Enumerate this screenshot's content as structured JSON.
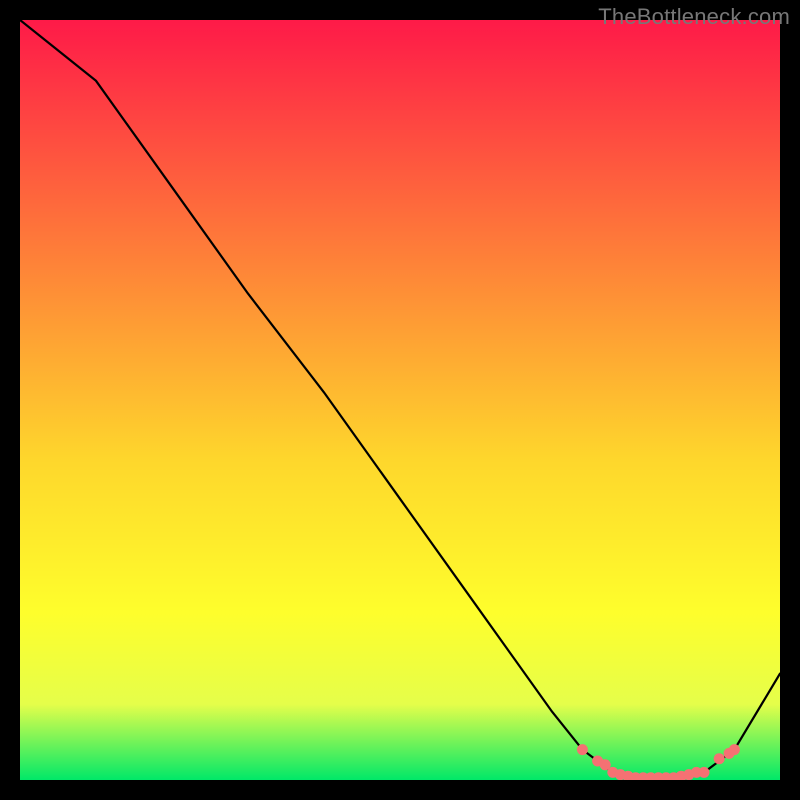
{
  "watermark": "TheBottleneck.com",
  "colors": {
    "gradient_top": "#fe1a48",
    "gradient_mid1": "#fe7c39",
    "gradient_mid2": "#fed72c",
    "gradient_mid3": "#fefe2c",
    "gradient_mid4": "#e5fe4a",
    "gradient_bottom": "#00e868",
    "curve": "#000000",
    "markers": "#f57173",
    "background": "#000000"
  },
  "chart_data": {
    "type": "line",
    "title": "",
    "xlabel": "",
    "ylabel": "",
    "xlim": [
      0,
      100
    ],
    "ylim": [
      0,
      100
    ],
    "curve": {
      "x": [
        0,
        5,
        10,
        20,
        30,
        40,
        50,
        60,
        65,
        70,
        74,
        78,
        82,
        86,
        90,
        94,
        100
      ],
      "y": [
        100,
        96,
        92,
        78,
        64,
        51,
        37,
        23,
        16,
        9,
        4,
        1,
        0.3,
        0.3,
        1,
        4,
        14
      ]
    },
    "series": [
      {
        "name": "flat-valley-markers",
        "x": [
          74,
          76,
          77,
          78,
          79,
          80,
          81,
          82,
          83,
          84,
          85,
          86,
          87,
          88,
          89,
          90,
          92,
          93.3,
          94
        ],
        "y": [
          4,
          2.5,
          2,
          1,
          0.7,
          0.5,
          0.3,
          0.3,
          0.3,
          0.3,
          0.3,
          0.3,
          0.5,
          0.7,
          1,
          1,
          2.8,
          3.5,
          4
        ]
      }
    ]
  }
}
